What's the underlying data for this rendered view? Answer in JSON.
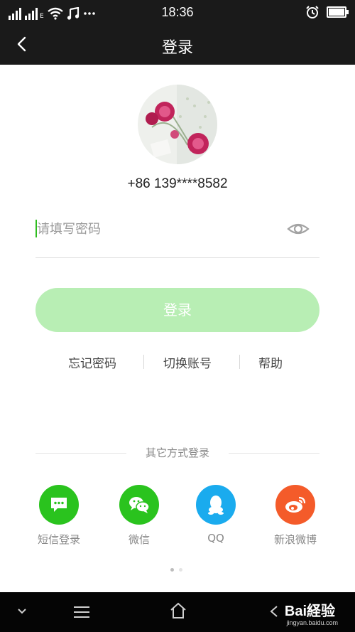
{
  "status_bar": {
    "time": "18:36"
  },
  "header": {
    "title": "登录"
  },
  "account": {
    "phone": "+86 139****8582"
  },
  "password": {
    "placeholder": "请填写密码"
  },
  "login_button": "登录",
  "links": [
    "忘记密码",
    "切换账号",
    "帮助"
  ],
  "other_login": {
    "title": "其它方式登录",
    "methods": [
      {
        "label": "短信登录",
        "icon": "sms-icon",
        "color": "#2ac31e"
      },
      {
        "label": "微信",
        "icon": "wechat-icon",
        "color": "#2ac31e"
      },
      {
        "label": "QQ",
        "icon": "qq-icon",
        "color": "#1aabee"
      },
      {
        "label": "新浪微博",
        "icon": "weibo-icon",
        "color": "#f45b2a"
      }
    ]
  },
  "watermark": {
    "brand": "Bai経验",
    "url": "jingyan.baidu.com"
  },
  "colors": {
    "accent": "#2ac31e",
    "button_disabled": "#b8eeb4",
    "bar": "#1a1a1a"
  }
}
